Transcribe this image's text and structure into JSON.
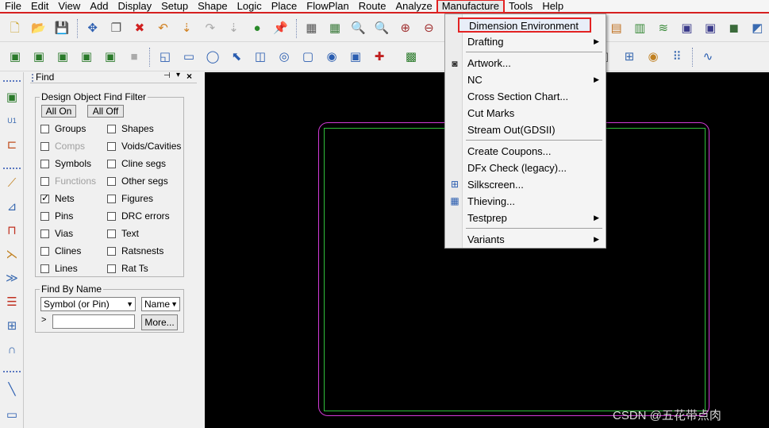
{
  "menubar": {
    "items": [
      "File",
      "Edit",
      "View",
      "Add",
      "Display",
      "Setup",
      "Shape",
      "Logic",
      "Place",
      "FlowPlan",
      "Route",
      "Analyze",
      "Manufacture",
      "Tools",
      "Help"
    ]
  },
  "manufacture_menu": {
    "items": [
      {
        "label": "Dimension Environment",
        "submenu": false
      },
      {
        "label": "Drafting",
        "submenu": true
      },
      {
        "label": "Artwork...",
        "submenu": false
      },
      {
        "label": "NC",
        "submenu": true
      },
      {
        "label": "Cross Section Chart...",
        "submenu": false
      },
      {
        "label": "Cut Marks",
        "submenu": false
      },
      {
        "label": "Stream Out(GDSII)",
        "submenu": false
      },
      {
        "label": "Create Coupons...",
        "submenu": false
      },
      {
        "label": "DFx Check (legacy)...",
        "submenu": false
      },
      {
        "label": "Silkscreen...",
        "submenu": false
      },
      {
        "label": "Thieving...",
        "submenu": false
      },
      {
        "label": "Testprep",
        "submenu": true
      },
      {
        "label": "Variants",
        "submenu": true
      }
    ]
  },
  "find_panel": {
    "title": "Find",
    "filter_group": "Design Object Find Filter",
    "all_on": "All On",
    "all_off": "All Off",
    "left_checks": [
      {
        "label": "Groups",
        "checked": false,
        "disabled": false
      },
      {
        "label": "Comps",
        "checked": false,
        "disabled": true
      },
      {
        "label": "Symbols",
        "checked": false,
        "disabled": false
      },
      {
        "label": "Functions",
        "checked": false,
        "disabled": true
      },
      {
        "label": "Nets",
        "checked": true,
        "disabled": false
      },
      {
        "label": "Pins",
        "checked": false,
        "disabled": false
      },
      {
        "label": "Vias",
        "checked": false,
        "disabled": false
      },
      {
        "label": "Clines",
        "checked": false,
        "disabled": false
      },
      {
        "label": "Lines",
        "checked": false,
        "disabled": false
      }
    ],
    "right_checks": [
      {
        "label": "Shapes",
        "checked": false,
        "disabled": false
      },
      {
        "label": "Voids/Cavities",
        "checked": false,
        "disabled": false
      },
      {
        "label": "Cline segs",
        "checked": false,
        "disabled": false
      },
      {
        "label": "Other segs",
        "checked": false,
        "disabled": false
      },
      {
        "label": "Figures",
        "checked": false,
        "disabled": false
      },
      {
        "label": "DRC errors",
        "checked": false,
        "disabled": false
      },
      {
        "label": "Text",
        "checked": false,
        "disabled": false
      },
      {
        "label": "Ratsnests",
        "checked": false,
        "disabled": false
      },
      {
        "label": "Rat Ts",
        "checked": false,
        "disabled": false
      }
    ],
    "find_by_name_group": "Find By Name",
    "type_select": "Symbol (or Pin)",
    "name_select": "Name",
    "more_button": "More...",
    "expand_glyph": ">"
  },
  "watermark": "CSDN @五花带点肉",
  "colors": {
    "highlight_red": "#e32222",
    "board_outline": "#d23ad6",
    "route_keepin": "#2fbf3a",
    "canvas": "#000000"
  }
}
